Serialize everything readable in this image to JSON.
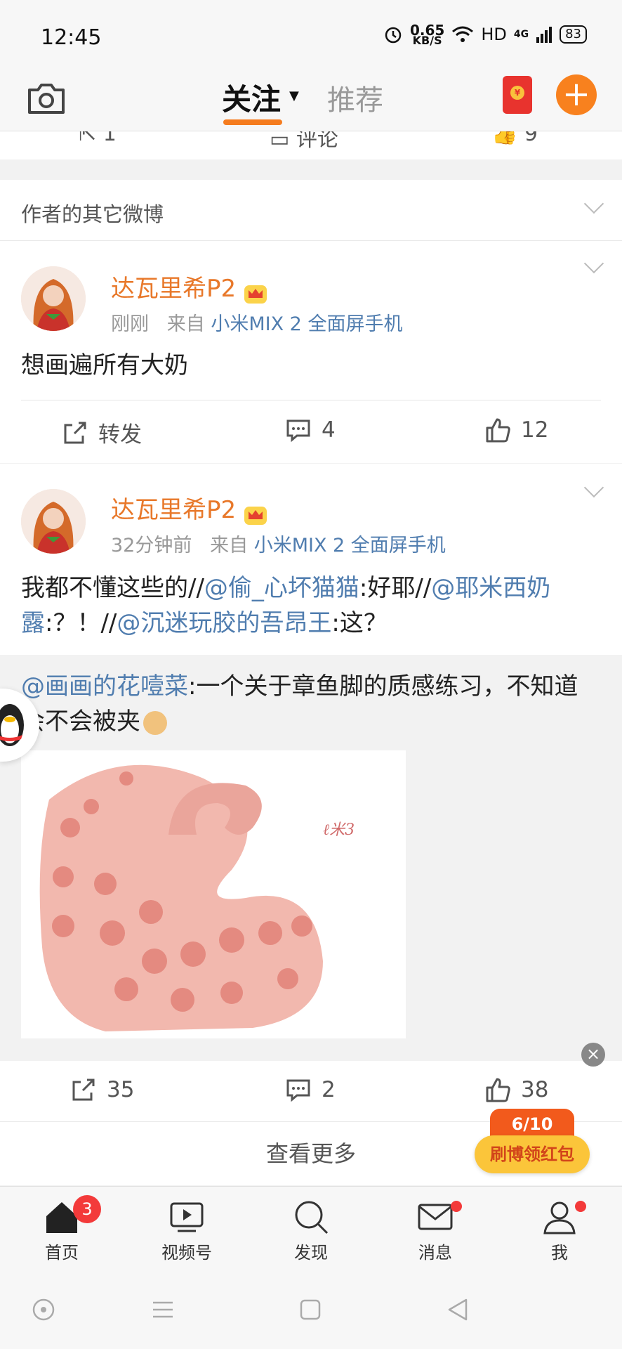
{
  "status": {
    "time": "12:45",
    "speed_value": "0.65",
    "speed_unit": "KB/S",
    "hd": "HD",
    "net": "4G",
    "battery": "83"
  },
  "topnav": {
    "tab_follow": "关注",
    "tab_recommend": "推荐",
    "accent": "#f57c1f"
  },
  "prev_post": {
    "repost_count": "1",
    "comment_label": "评论",
    "like_count": "9"
  },
  "section": {
    "title": "作者的其它微博"
  },
  "post1": {
    "username": "达瓦里希P2",
    "time": "刚刚",
    "from_label": "来自",
    "source": "小米MIX 2 全面屏手机",
    "text": "想画遍所有大奶",
    "repost_label": "转发",
    "comments": "4",
    "likes": "12"
  },
  "post2": {
    "username": "达瓦里希P2",
    "time": "32分钟前",
    "from_label": "来自",
    "source": "小米MIX 2 全面屏手机",
    "text_1": "我都不懂这些的//",
    "mention_1": "@偷_心坏猫猫",
    "text_2": ":好耶//",
    "mention_2": "@耶米西奶露",
    "text_3": ":？！//",
    "mention_3": "@沉迷玩胶的吾昂王",
    "text_4": ":这？",
    "quote_mention": "@画画的花噎菜",
    "quote_text": ":一个关于章鱼脚的质感练习，不知道会不会被夹",
    "reposts": "35",
    "comments": "2",
    "likes": "38"
  },
  "see_more": "查看更多",
  "promo": {
    "progress": "6/10",
    "label": "刷博领红包"
  },
  "bottomnav": {
    "home": "首页",
    "home_badge": "3",
    "video": "视频号",
    "discover": "发现",
    "messages": "消息",
    "me": "我"
  }
}
